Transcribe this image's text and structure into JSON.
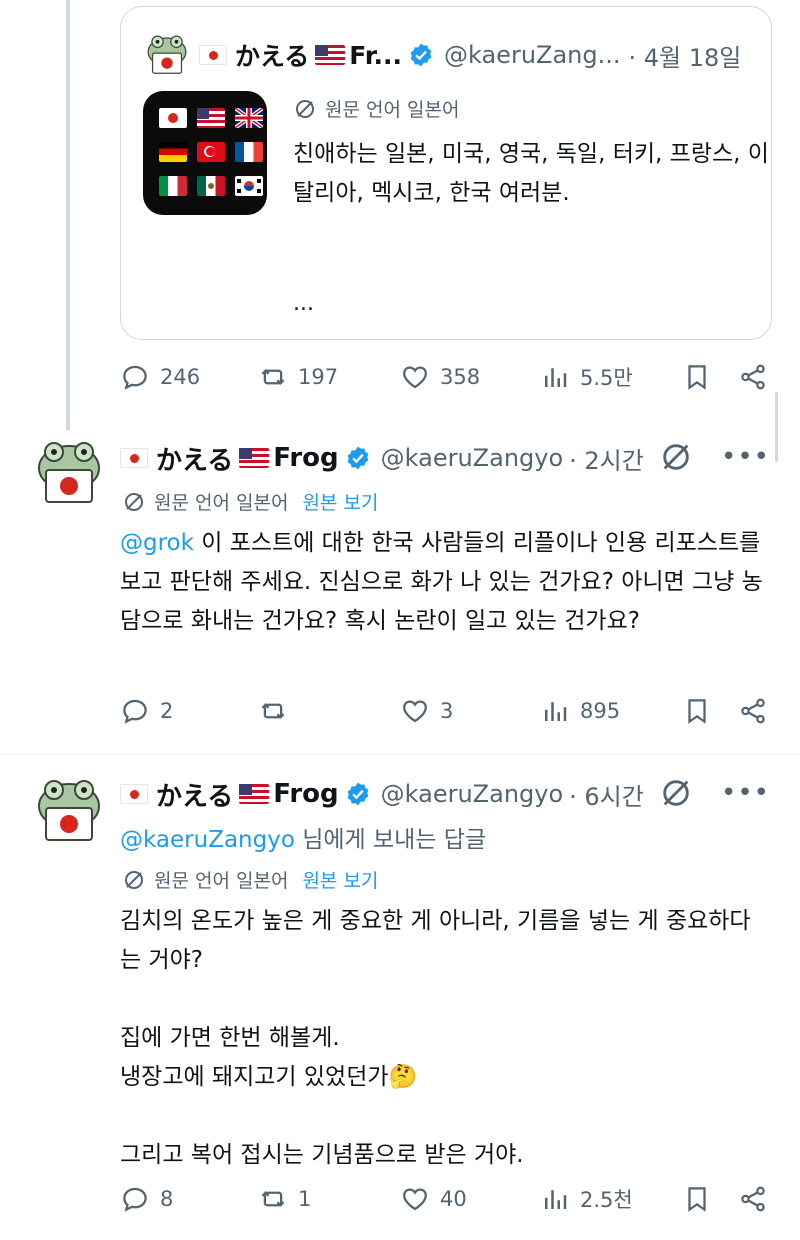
{
  "quote": {
    "flag_left": "🇯🇵",
    "name_short": "かえる",
    "name_rest": "Fr...",
    "handle": "@kaeruZang...",
    "time": "4월 18일",
    "translate_label": "원문 언어 일본어",
    "text": "친애하는 일본, 미국, 영국, 독일, 터키, 프랑스, 이탈리아, 멕시코, 한국 여러분.",
    "ellipsis": "...",
    "app_icon_flags": [
      "japan",
      "usa",
      "uk",
      "germany",
      "turkey",
      "france",
      "italy",
      "mexico",
      "korea"
    ]
  },
  "first_actions": {
    "replies": "246",
    "reposts": "197",
    "likes": "358",
    "views": "5.5만"
  },
  "tweet1": {
    "name": "かえる",
    "name_suffix": "Frog",
    "handle": "@kaeruZangyo",
    "time": "· 2시간",
    "translate_label": "원문 언어 일본어",
    "translate_link": "원본 보기",
    "mention": "@grok",
    "text": " 이 포스트에 대한 한국 사람들의 리플이나 인용 리포스트를 보고 판단해 주세요. 진심으로 화가 나 있는 건가요? 아니면 그냥 농담으로 화내는 건가요? 혹시 논란이 일고 있는 건가요?",
    "actions": {
      "replies": "2",
      "reposts": "",
      "likes": "3",
      "views": "895"
    }
  },
  "tweet2": {
    "name": "かえる",
    "name_suffix": "Frog",
    "handle": "@kaeruZangyo",
    "time": "· 6시간",
    "reply_to_handle": "@kaeruZangyo",
    "reply_to_suffix": " 님에게 보내는 답글",
    "translate_label": "원문 언어 일본어",
    "translate_link": "원본 보기",
    "text": "김치의 온도가 높은 게 중요한 게 아니라, 기름을 넣는 게 중요하다는 거야?\n\n집에 가면 한번 해볼게.\n냉장고에 돼지고기 있었던가🤔\n\n그리고 복어 접시는 기념품으로 받은 거야.",
    "actions": {
      "replies": "8",
      "reposts": "1",
      "likes": "40",
      "views": "2.5천"
    }
  },
  "colors": {
    "link": "#1d9bf0",
    "muted": "#536471",
    "verified": "#1d9bf0"
  }
}
